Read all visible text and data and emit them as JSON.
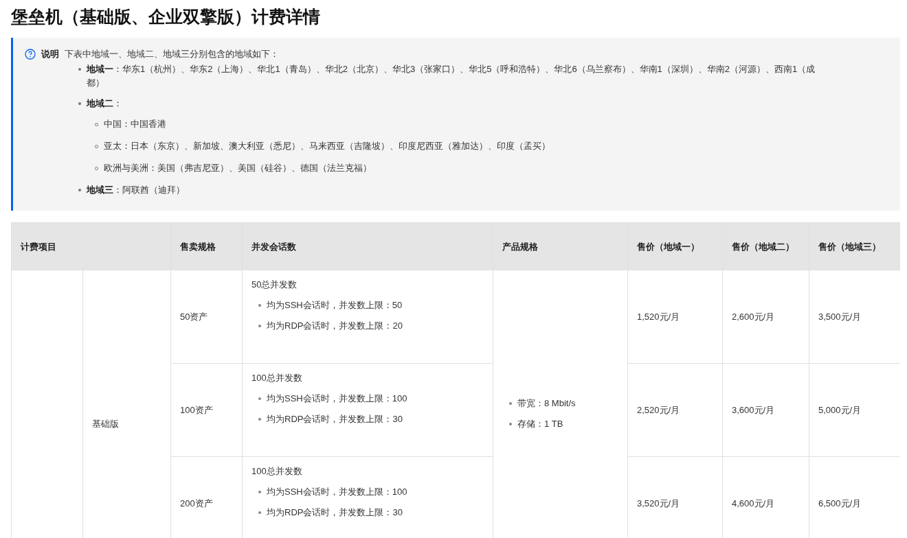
{
  "title": "堡垒机（基础版、企业双擎版）计费详情",
  "note": {
    "label": "说明",
    "intro": "下表中地域一、地域二、地域三分别包含的地域如下：",
    "items": [
      {
        "text": "**地域一**：华东1（杭州）、华东2（上海）、华北1（青岛）、华北2（北京）、华北3（张家口）、华北5（呼和浩特）、华北6（乌兰察布）、华南1（深圳）、华南2（河源）、西南1（成都）"
      },
      {
        "text": "**地域二**：",
        "children": [
          "中国：中国香港",
          "亚太：日本（东京）、新加坡、澳大利亚（悉尼）、马来西亚（吉隆坡）、印度尼西亚（雅加达）、印度（孟买）",
          "欧洲与美洲：美国（弗吉尼亚）、美国（硅谷）、德国（法兰克福）"
        ]
      },
      {
        "text": "**地域三**：阿联酋（迪拜）"
      }
    ]
  },
  "table": {
    "columns": [
      "计费项目",
      "售卖规格",
      "并发会话数",
      "产品规格",
      "售价（地域一）",
      "售价（地域二）",
      "售价（地域三）"
    ],
    "edition": "基础版",
    "product_spec": [
      "带宽：8 Mbit/s",
      "存储：1 TB"
    ],
    "rows": [
      {
        "sale_spec": "50资产",
        "concurrency": "50总并发数",
        "limits": [
          "均为SSH会话时，并发数上限：50",
          "均为RDP会话时，并发数上限：20"
        ],
        "prices": [
          "1,520元/月",
          "2,600元/月",
          "3,500元/月"
        ]
      },
      {
        "sale_spec": "100资产",
        "concurrency": "100总并发数",
        "limits": [
          "均为SSH会话时，并发数上限：100",
          "均为RDP会话时，并发数上限：30"
        ],
        "prices": [
          "2,520元/月",
          "3,600元/月",
          "5,000元/月"
        ]
      },
      {
        "sale_spec": "200资产",
        "concurrency": "100总并发数",
        "limits": [
          "均为SSH会话时，并发数上限：100",
          "均为RDP会话时，并发数上限：30"
        ],
        "prices": [
          "3,520元/月",
          "4,600元/月",
          "6,500元/月"
        ]
      }
    ]
  }
}
